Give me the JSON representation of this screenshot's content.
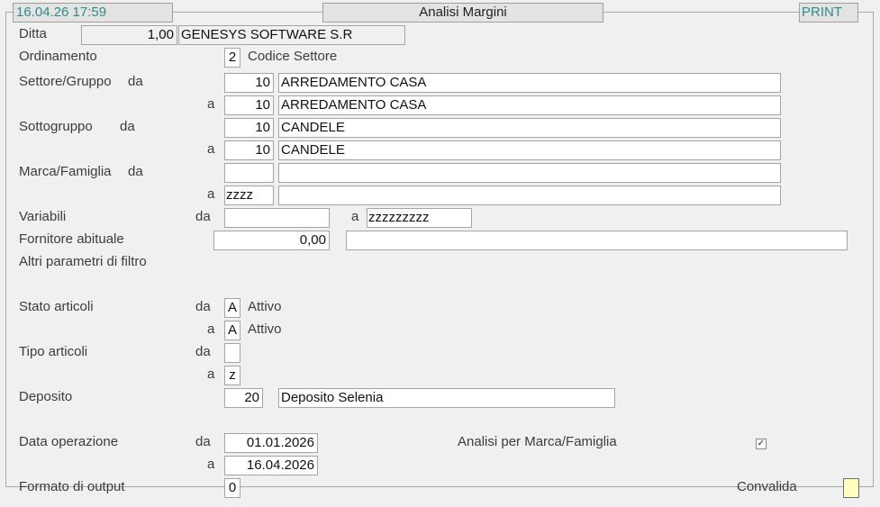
{
  "header": {
    "datetime": "16.04.26 17:59",
    "title": "Analisi Margini",
    "print": "PRINT"
  },
  "form": {
    "ditta": {
      "label": "Ditta",
      "value": "1,00",
      "name": "GENESYS SOFTWARE S.R"
    },
    "ordinamento": {
      "label": "Ordinamento",
      "value": "2",
      "desc": "Codice Settore"
    },
    "settore": {
      "label": "Settore/Gruppo",
      "da_label": "da",
      "a_label": "a",
      "from_code": "10",
      "from_desc": "ARREDAMENTO CASA",
      "to_code": "10",
      "to_desc": "ARREDAMENTO CASA"
    },
    "sottogruppo": {
      "label": "Sottogruppo",
      "da_label": "da",
      "a_label": "a",
      "from_code": "10",
      "from_desc": "CANDELE",
      "to_code": "10",
      "to_desc": "CANDELE"
    },
    "marca": {
      "label": "Marca/Famiglia",
      "da_label": "da",
      "a_label": "a",
      "from_code": "",
      "from_desc": "",
      "to_code": "zzzz",
      "to_desc": ""
    },
    "variabili": {
      "label": "Variabili",
      "da_label": "da",
      "a_label": "a",
      "from": "",
      "to": "zzzzzzzzz"
    },
    "fornitore": {
      "label": "Fornitore abituale",
      "value": "0,00",
      "desc": ""
    },
    "altri": {
      "label": "Altri parametri di filtro"
    },
    "stato": {
      "label": "Stato articoli",
      "da_label": "da",
      "a_label": "a",
      "from": "A",
      "from_desc": "Attivo",
      "to": "A",
      "to_desc": "Attivo"
    },
    "tipo": {
      "label": "Tipo articoli",
      "da_label": "da",
      "a_label": "a",
      "from": "",
      "to": "z"
    },
    "deposito": {
      "label": "Deposito",
      "code": "20",
      "desc": "Deposito Selenia"
    },
    "data_operazione": {
      "label": "Data operazione",
      "da_label": "da",
      "a_label": "a",
      "from": "01.01.2026",
      "to": "16.04.2026"
    },
    "analisi_marca": {
      "label": "Analisi per Marca/Famiglia",
      "checked": true,
      "check_glyph": "✓"
    },
    "formato": {
      "label": "Formato di output",
      "value": "0"
    },
    "convalida": {
      "label": "Convalida"
    }
  }
}
